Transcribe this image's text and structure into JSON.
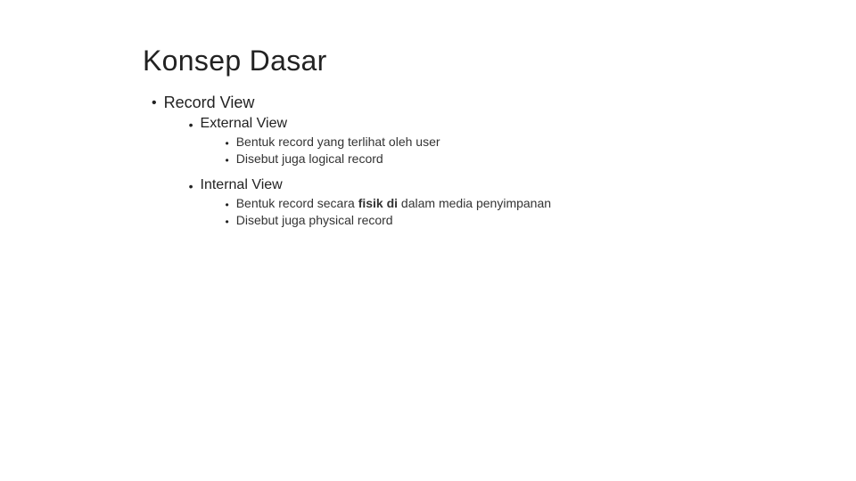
{
  "slide": {
    "title": "Konsep Dasar",
    "level1": [
      {
        "label": "Record View",
        "level2": [
          {
            "label": "External View",
            "level3": [
              {
                "text": "Bentuk record yang terlihat oleh user"
              },
              {
                "text": "Disebut juga logical record"
              }
            ]
          },
          {
            "label": "Internal View",
            "level3": [
              {
                "text": "Bentuk record secara fisik di dalam media penyimpanan",
                "bold_parts": [
                  "fisik",
                  "di"
                ]
              },
              {
                "text": "Disebut juga physical record"
              }
            ]
          }
        ]
      }
    ]
  }
}
